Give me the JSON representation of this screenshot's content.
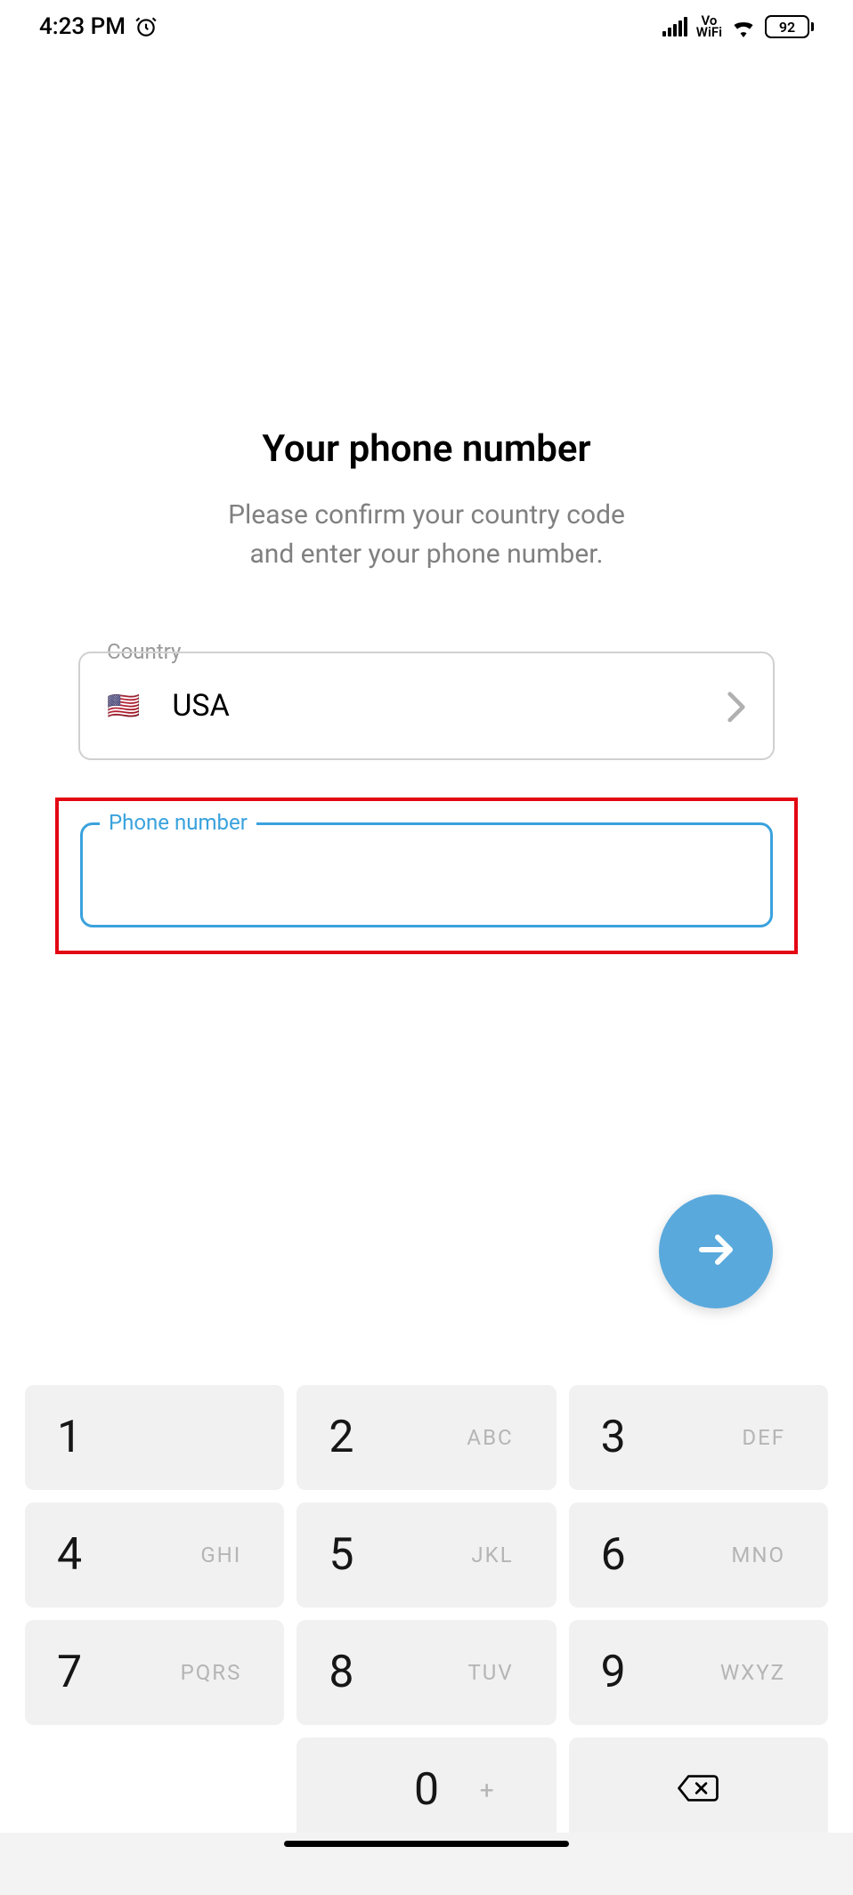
{
  "statusbar": {
    "time": "4:23 PM",
    "vo_wifi_top": "Vo",
    "vo_wifi_bottom": "WiFi",
    "battery": "92"
  },
  "header": {
    "title": "Your phone number",
    "subtitle_line1": "Please confirm your country code",
    "subtitle_line2": "and enter your phone number."
  },
  "country": {
    "label": "Country",
    "flag": "🇺🇸",
    "name": "USA"
  },
  "phone": {
    "label": "Phone number",
    "value": ""
  },
  "keypad": [
    {
      "digit": "1",
      "letters": ""
    },
    {
      "digit": "2",
      "letters": "ABC"
    },
    {
      "digit": "3",
      "letters": "DEF"
    },
    {
      "digit": "4",
      "letters": "GHI"
    },
    {
      "digit": "5",
      "letters": "JKL"
    },
    {
      "digit": "6",
      "letters": "MNO"
    },
    {
      "digit": "7",
      "letters": "PQRS"
    },
    {
      "digit": "8",
      "letters": "TUV"
    },
    {
      "digit": "9",
      "letters": "WXYZ"
    },
    {
      "digit": "0",
      "letters": "+"
    }
  ],
  "colors": {
    "accent": "#3aa2dd",
    "highlight": "#e30613",
    "fab": "#59a9dd"
  }
}
